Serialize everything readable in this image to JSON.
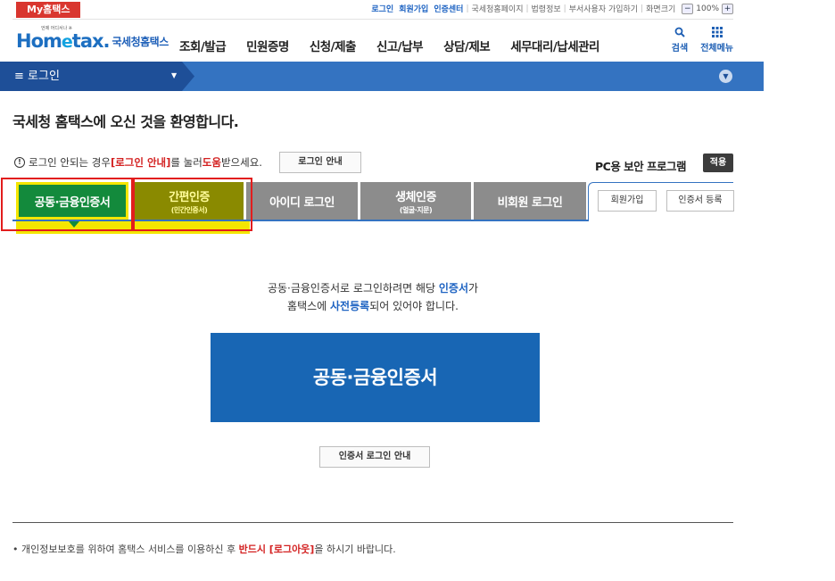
{
  "topbar": {
    "my_label": "My홈택스",
    "links": [
      "로그인",
      "회원가입",
      "인증센터",
      "국세청홈페이지",
      "법령정보",
      "부서사용자 가입하기",
      "화면크기"
    ],
    "zoom_minus": "−",
    "zoom_value": "100%",
    "zoom_plus": "+"
  },
  "header": {
    "logo_small": "언제 어디서나 ※",
    "logo_main": "Hom",
    "logo_e": "e",
    "logo_tax": "tax.",
    "logo_kr": "국세청홈택스",
    "nav": [
      "조회/발급",
      "민원증명",
      "신청/제출",
      "신고/납부",
      "상담/제보",
      "세무대리/납세관리"
    ],
    "search_label": "검색",
    "menu_label": "전체메뉴"
  },
  "breadcrumb": {
    "menu_label": "≡  로그인"
  },
  "welcome": "국세청 홈택스에 오신 것을 환영합니다.",
  "notice": {
    "icon": "!",
    "p1": "로그인 안되는 경우 ",
    "p2": "[로그인 안내]",
    "p3": "를 눌러 ",
    "p4": "도움",
    "p5": "받으세요.",
    "guide_button": "로그인 안내"
  },
  "pc_security": {
    "label": "PC용 보안 프로그램",
    "apply_button": "적용"
  },
  "tabs": [
    {
      "label": "공동·금융인증서",
      "sub": ""
    },
    {
      "label": "간편인증",
      "sub": "(민간인증서)"
    },
    {
      "label": "아이디 로그인",
      "sub": ""
    },
    {
      "label": "생체인증",
      "sub": "(얼굴·지문)"
    },
    {
      "label": "비회원 로그인",
      "sub": ""
    }
  ],
  "side_buttons": {
    "join": "회원가입",
    "register_cert": "인증서 등록"
  },
  "message": {
    "l1a": "공동·금융인증서로 로그인하려면 해당 ",
    "l1b": "인증서",
    "l1c": "가",
    "l2a": "홈택스에 ",
    "l2b": "사전등록",
    "l2c": "되어 있어야 합니다."
  },
  "cert_login_button": "공동·금융인증서",
  "cert_guide_button": "인증서 로그인 안내",
  "footnote": {
    "a": "• 개인정보보호를 위하여 홈택스 서비스를 이용하신 후 ",
    "b": "반드시 [로그아웃]",
    "c": "을 하시기 바랍니다."
  },
  "colors": {
    "tab_active": "#138a3c",
    "tab_simple": "#8a8a00",
    "tab_inactive": "#8c8c8c",
    "highlight_box": "#e21d1d",
    "cert_button": "#1866b4",
    "breadcrumb": "#3473c1"
  }
}
